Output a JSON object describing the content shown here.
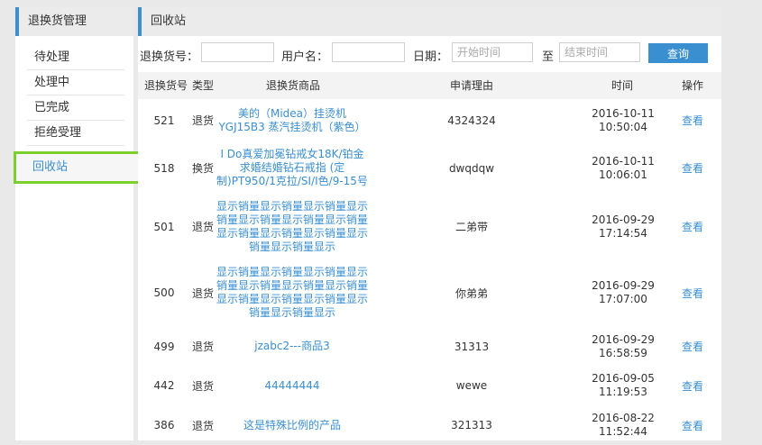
{
  "sidebar": {
    "title": "退换货管理",
    "items": [
      {
        "label": "待处理"
      },
      {
        "label": "处理中"
      },
      {
        "label": "已完成"
      },
      {
        "label": "拒绝受理"
      },
      {
        "label": "回收站"
      }
    ],
    "active_index": 4
  },
  "main": {
    "title": "回收站",
    "search": {
      "return_no_label": "退换货号：",
      "username_label": "用户名：",
      "date_label": "日期：",
      "start_placeholder": "开始时间",
      "to_label": "至",
      "end_placeholder": "结束时间",
      "query_label": "查询"
    },
    "table": {
      "headers": {
        "no": "退换货号",
        "type": "类型",
        "product": "退换货商品",
        "reason": "申请理由",
        "time": "时间",
        "action": "操作"
      },
      "rows": [
        {
          "no": "521",
          "type": "退货",
          "product": "美的（Midea）挂烫机 YGJ15B3 蒸汽挂烫机（紫色）",
          "reason": "4324324",
          "date": "2016-10-11",
          "clock": "10:50:04",
          "action": "查看"
        },
        {
          "no": "518",
          "type": "换货",
          "product": "I Do真爱加冕钻戒女18K/铂金求婚结婚钻石戒指 (定制)PT950/1克拉/SI/I色/9-15号",
          "reason": "dwqdqw",
          "date": "2016-10-11",
          "clock": "10:06:01",
          "action": "查看"
        },
        {
          "no": "501",
          "type": "退货",
          "product": "显示销量显示销量显示销量显示销量显示销量显示销量显示销量显示销量显示销量显示销量显示销量显示销量显示",
          "reason": "二弟带",
          "date": "2016-09-29",
          "clock": "17:14:54",
          "action": "查看"
        },
        {
          "no": "500",
          "type": "退货",
          "product": "显示销量显示销量显示销量显示销量显示销量显示销量显示销量显示销量显示销量显示销量显示销量显示销量显示",
          "reason": "你弟弟",
          "date": "2016-09-29",
          "clock": "17:07:00",
          "action": "查看"
        },
        {
          "no": "499",
          "type": "退货",
          "product": "jzabc2---商品3",
          "reason": "31313",
          "date": "2016-09-29",
          "clock": "16:58:59",
          "action": "查看"
        },
        {
          "no": "442",
          "type": "退货",
          "product": "44444444",
          "reason": "wewe",
          "date": "2016-09-05",
          "clock": "11:19:53",
          "action": "查看"
        },
        {
          "no": "386",
          "type": "退货",
          "product": "这是特殊比例的产品",
          "reason": "321313",
          "date": "2016-08-22",
          "clock": "11:52:44",
          "action": "查看"
        }
      ]
    }
  }
}
